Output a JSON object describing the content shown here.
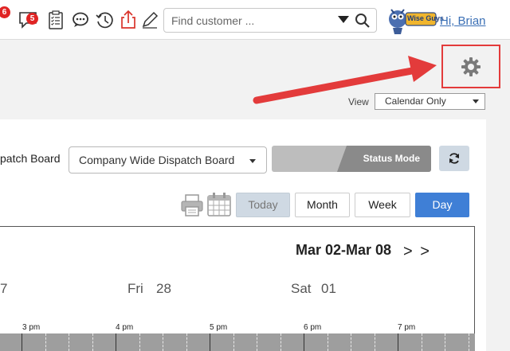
{
  "header": {
    "messages_badge_left": "6",
    "messages_badge": "5",
    "search": {
      "placeholder": "Find customer ..."
    },
    "greeting": "Hi, Brian",
    "logo_text": "Wise Guys"
  },
  "view": {
    "label": "View",
    "selected": "Calendar Only"
  },
  "dispatch": {
    "label": "patch Board",
    "board": "Company Wide Dispatch Board",
    "status_mode": "Status Mode"
  },
  "calendar_buttons": {
    "today": "Today",
    "month": "Month",
    "week": "Week",
    "day": "Day"
  },
  "calendar": {
    "range": "Mar 02-Mar 08",
    "nav": "> >",
    "days": [
      {
        "name": "",
        "num": "7"
      },
      {
        "name": "Fri",
        "num": "28"
      },
      {
        "name": "Sat",
        "num": "01"
      }
    ],
    "times": [
      "3 pm",
      "4 pm",
      "5 pm",
      "6 pm",
      "7 pm"
    ]
  },
  "colors": {
    "accent": "#3f7fd6",
    "alert": "#e33b3b",
    "link": "#3a6fb5"
  }
}
